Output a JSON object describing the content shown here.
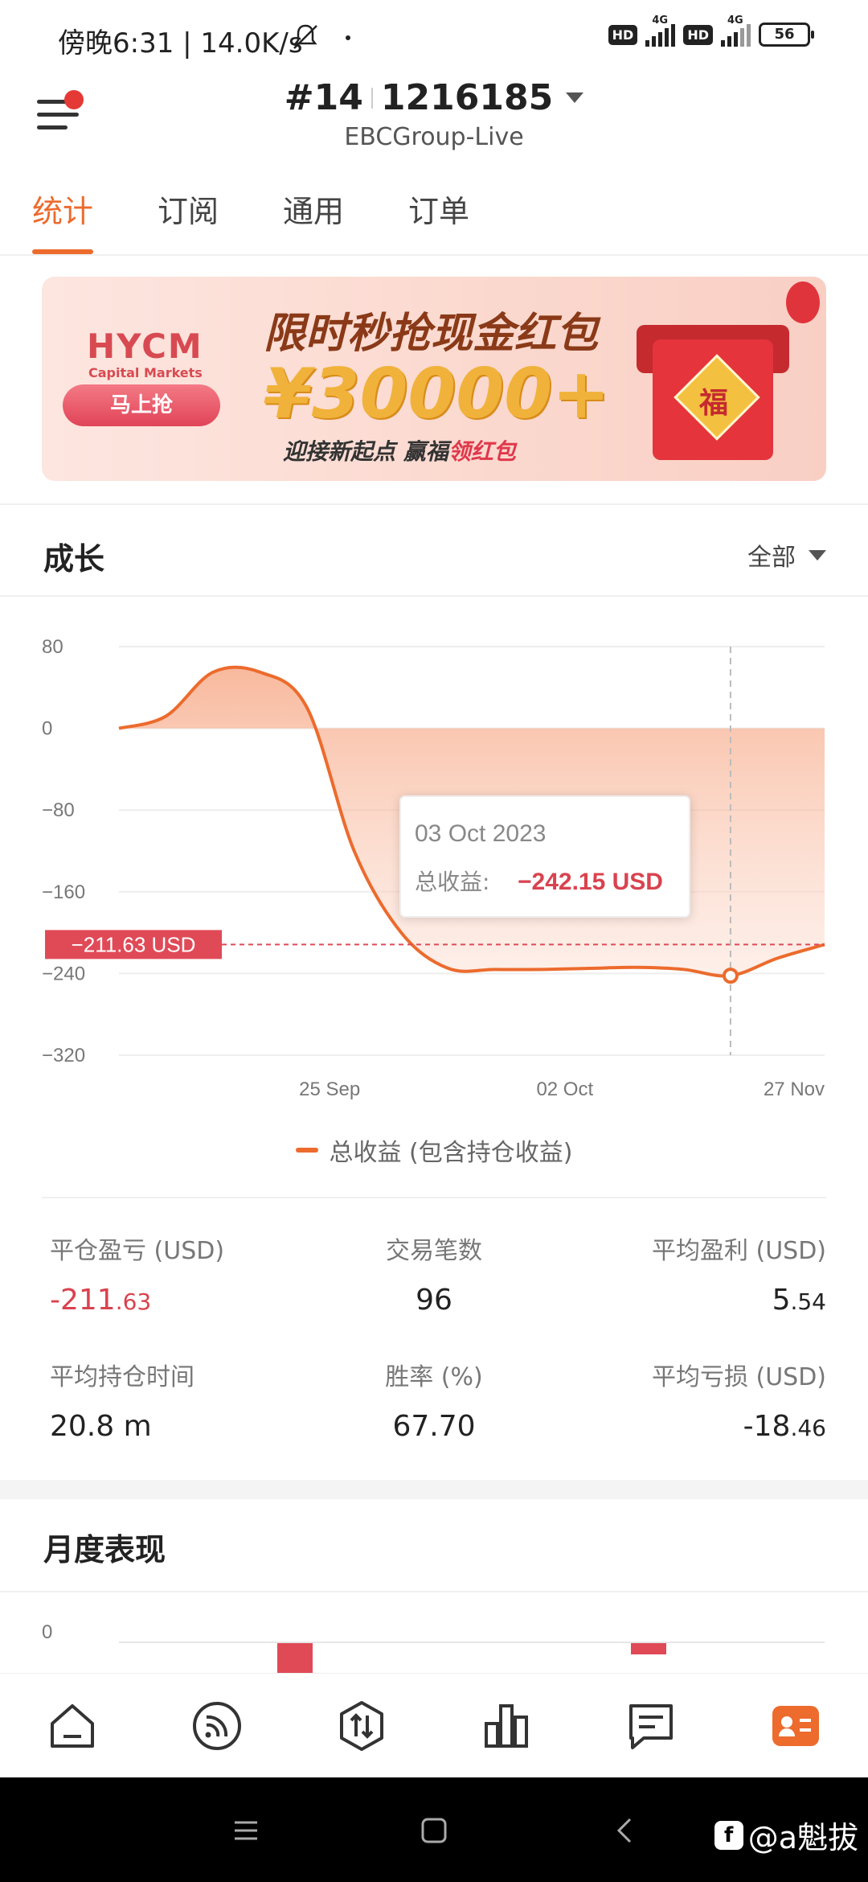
{
  "status_bar": {
    "time_speed": "傍晚6:31 | 14.0K/s",
    "hd1": "HD",
    "net1": "4G",
    "hd2": "HD",
    "net2": "4G",
    "battery": "56"
  },
  "header": {
    "account_prefix": "#14",
    "account_number": "1216185",
    "server": "EBCGroup-Live"
  },
  "tabs": [
    "统计",
    "订阅",
    "通用",
    "订单"
  ],
  "banner": {
    "logo": "HYCM",
    "logo_sub": "Capital Markets",
    "button": "马上抢",
    "title": "限时秒抢现金红包",
    "amount": "¥30000+",
    "tagline_a": "迎接新起点  赢福",
    "tagline_b": "领红包",
    "envelope_char": "福"
  },
  "growth": {
    "title": "成长",
    "filter": "全部"
  },
  "chart_data": {
    "type": "area",
    "ylim": [
      -320,
      80
    ],
    "y_ticks": [
      "80",
      "0",
      "-80",
      "-160",
      "-240",
      "-320"
    ],
    "x_ticks": [
      "25 Sep",
      "02 Oct",
      "27 Nov"
    ],
    "series": [
      {
        "name": "总收益 (包含持仓收益)",
        "values": [
          0,
          12,
          55,
          55,
          20,
          -120,
          -200,
          -235,
          -236,
          -236,
          -235,
          -234,
          -236,
          -242.15,
          -225,
          -211.63
        ]
      }
    ],
    "current_value_label": "-211.63 USD",
    "current_value": -211.63,
    "tooltip": {
      "date": "03 Oct 2023",
      "label": "总收益:",
      "value": "-242.15 USD"
    }
  },
  "stats": [
    {
      "label": "平仓盈亏 (USD)",
      "int": "-211",
      "dec": ".63",
      "negative": true
    },
    {
      "label": "交易笔数",
      "int": "96",
      "dec": "",
      "negative": false
    },
    {
      "label": "平均盈利 (USD)",
      "int": "5",
      "dec": ".54",
      "negative": false
    },
    {
      "label": "平均持仓时间",
      "int": "20.8 m",
      "dec": "",
      "negative": false
    },
    {
      "label": "胜率 (%)",
      "int": "67.70",
      "dec": "",
      "negative": false
    },
    {
      "label": "平均亏损 (USD)",
      "int": "-18",
      "dec": ".46",
      "negative": false
    }
  ],
  "monthly": {
    "title": "月度表现",
    "y_tick": "0"
  },
  "bottom_nav": [
    "home-icon",
    "signal-icon",
    "trade-icon",
    "chart-icon",
    "message-icon",
    "profile-icon"
  ],
  "watermark": {
    "logo": "f",
    "text": "@a魁拔"
  },
  "colors": {
    "accent": "#ec6b2d",
    "negative": "#d9434f",
    "marker": "#e04a57"
  }
}
